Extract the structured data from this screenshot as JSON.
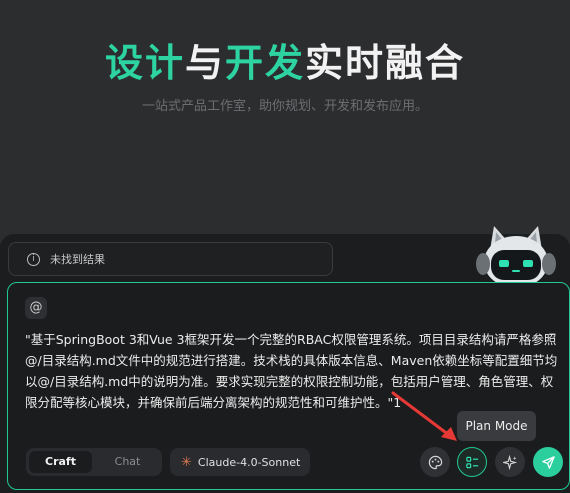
{
  "hero": {
    "title_part1": "设计与",
    "title_part2": "开发",
    "title_part3": "实时融合",
    "title_lead_a": "设计",
    "title_lead_b": "与",
    "subtitle": "一站式产品工作室，助你规划、开发和发布应用。"
  },
  "notice": {
    "icon": "info-icon",
    "text": "未找到结果"
  },
  "composer": {
    "mention_symbol": "@",
    "prompt": "\"基于SpringBoot 3和Vue 3框架开发一个完整的RBAC权限管理系统。项目目录结构请严格参照@/目录结构.md文件中的规范进行搭建。技术栈的具体版本信息、Maven依赖坐标等配置细节均以@/目录结构.md中的说明为准。要求实现完整的权限控制功能，包括用户管理、角色管理、权限分配等核心模块，并确保前后端分离架构的规范性和可维护性。\"1"
  },
  "mode_toggle": {
    "options": [
      "Craft",
      "Chat"
    ],
    "selected": "Craft"
  },
  "model": {
    "icon": "sparkle-icon",
    "label": "Claude-4.0-Sonnet"
  },
  "actions": {
    "palette_icon": "palette-icon",
    "plan_icon": "plan-list-icon",
    "magic_icon": "magic-sparkle-icon",
    "send_icon": "send-icon"
  },
  "tooltip": {
    "text": "Plan Mode"
  },
  "colors": {
    "accent": "#22c893",
    "background": "#2c2d2f",
    "panel": "#1b1c1e"
  }
}
